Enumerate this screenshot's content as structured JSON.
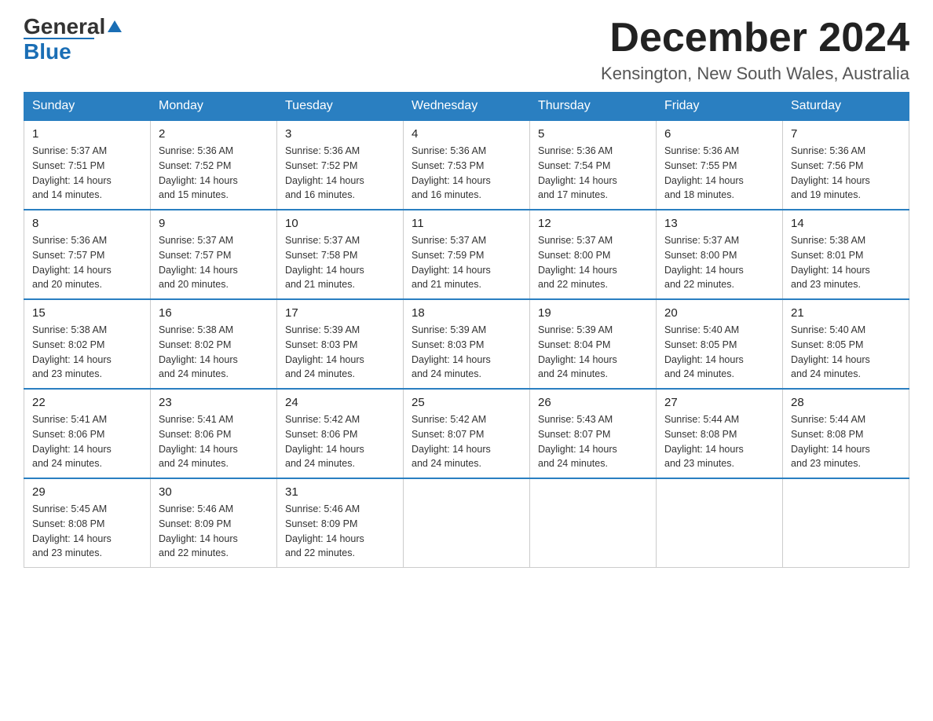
{
  "header": {
    "logo_general": "General",
    "logo_blue": "Blue",
    "month_title": "December 2024",
    "location": "Kensington, New South Wales, Australia"
  },
  "days_of_week": [
    "Sunday",
    "Monday",
    "Tuesday",
    "Wednesday",
    "Thursday",
    "Friday",
    "Saturday"
  ],
  "weeks": [
    [
      {
        "day": "1",
        "sunrise": "5:37 AM",
        "sunset": "7:51 PM",
        "daylight": "14 hours and 14 minutes."
      },
      {
        "day": "2",
        "sunrise": "5:36 AM",
        "sunset": "7:52 PM",
        "daylight": "14 hours and 15 minutes."
      },
      {
        "day": "3",
        "sunrise": "5:36 AM",
        "sunset": "7:52 PM",
        "daylight": "14 hours and 16 minutes."
      },
      {
        "day": "4",
        "sunrise": "5:36 AM",
        "sunset": "7:53 PM",
        "daylight": "14 hours and 16 minutes."
      },
      {
        "day": "5",
        "sunrise": "5:36 AM",
        "sunset": "7:54 PM",
        "daylight": "14 hours and 17 minutes."
      },
      {
        "day": "6",
        "sunrise": "5:36 AM",
        "sunset": "7:55 PM",
        "daylight": "14 hours and 18 minutes."
      },
      {
        "day": "7",
        "sunrise": "5:36 AM",
        "sunset": "7:56 PM",
        "daylight": "14 hours and 19 minutes."
      }
    ],
    [
      {
        "day": "8",
        "sunrise": "5:36 AM",
        "sunset": "7:57 PM",
        "daylight": "14 hours and 20 minutes."
      },
      {
        "day": "9",
        "sunrise": "5:37 AM",
        "sunset": "7:57 PM",
        "daylight": "14 hours and 20 minutes."
      },
      {
        "day": "10",
        "sunrise": "5:37 AM",
        "sunset": "7:58 PM",
        "daylight": "14 hours and 21 minutes."
      },
      {
        "day": "11",
        "sunrise": "5:37 AM",
        "sunset": "7:59 PM",
        "daylight": "14 hours and 21 minutes."
      },
      {
        "day": "12",
        "sunrise": "5:37 AM",
        "sunset": "8:00 PM",
        "daylight": "14 hours and 22 minutes."
      },
      {
        "day": "13",
        "sunrise": "5:37 AM",
        "sunset": "8:00 PM",
        "daylight": "14 hours and 22 minutes."
      },
      {
        "day": "14",
        "sunrise": "5:38 AM",
        "sunset": "8:01 PM",
        "daylight": "14 hours and 23 minutes."
      }
    ],
    [
      {
        "day": "15",
        "sunrise": "5:38 AM",
        "sunset": "8:02 PM",
        "daylight": "14 hours and 23 minutes."
      },
      {
        "day": "16",
        "sunrise": "5:38 AM",
        "sunset": "8:02 PM",
        "daylight": "14 hours and 24 minutes."
      },
      {
        "day": "17",
        "sunrise": "5:39 AM",
        "sunset": "8:03 PM",
        "daylight": "14 hours and 24 minutes."
      },
      {
        "day": "18",
        "sunrise": "5:39 AM",
        "sunset": "8:03 PM",
        "daylight": "14 hours and 24 minutes."
      },
      {
        "day": "19",
        "sunrise": "5:39 AM",
        "sunset": "8:04 PM",
        "daylight": "14 hours and 24 minutes."
      },
      {
        "day": "20",
        "sunrise": "5:40 AM",
        "sunset": "8:05 PM",
        "daylight": "14 hours and 24 minutes."
      },
      {
        "day": "21",
        "sunrise": "5:40 AM",
        "sunset": "8:05 PM",
        "daylight": "14 hours and 24 minutes."
      }
    ],
    [
      {
        "day": "22",
        "sunrise": "5:41 AM",
        "sunset": "8:06 PM",
        "daylight": "14 hours and 24 minutes."
      },
      {
        "day": "23",
        "sunrise": "5:41 AM",
        "sunset": "8:06 PM",
        "daylight": "14 hours and 24 minutes."
      },
      {
        "day": "24",
        "sunrise": "5:42 AM",
        "sunset": "8:06 PM",
        "daylight": "14 hours and 24 minutes."
      },
      {
        "day": "25",
        "sunrise": "5:42 AM",
        "sunset": "8:07 PM",
        "daylight": "14 hours and 24 minutes."
      },
      {
        "day": "26",
        "sunrise": "5:43 AM",
        "sunset": "8:07 PM",
        "daylight": "14 hours and 24 minutes."
      },
      {
        "day": "27",
        "sunrise": "5:44 AM",
        "sunset": "8:08 PM",
        "daylight": "14 hours and 23 minutes."
      },
      {
        "day": "28",
        "sunrise": "5:44 AM",
        "sunset": "8:08 PM",
        "daylight": "14 hours and 23 minutes."
      }
    ],
    [
      {
        "day": "29",
        "sunrise": "5:45 AM",
        "sunset": "8:08 PM",
        "daylight": "14 hours and 23 minutes."
      },
      {
        "day": "30",
        "sunrise": "5:46 AM",
        "sunset": "8:09 PM",
        "daylight": "14 hours and 22 minutes."
      },
      {
        "day": "31",
        "sunrise": "5:46 AM",
        "sunset": "8:09 PM",
        "daylight": "14 hours and 22 minutes."
      },
      null,
      null,
      null,
      null
    ]
  ]
}
